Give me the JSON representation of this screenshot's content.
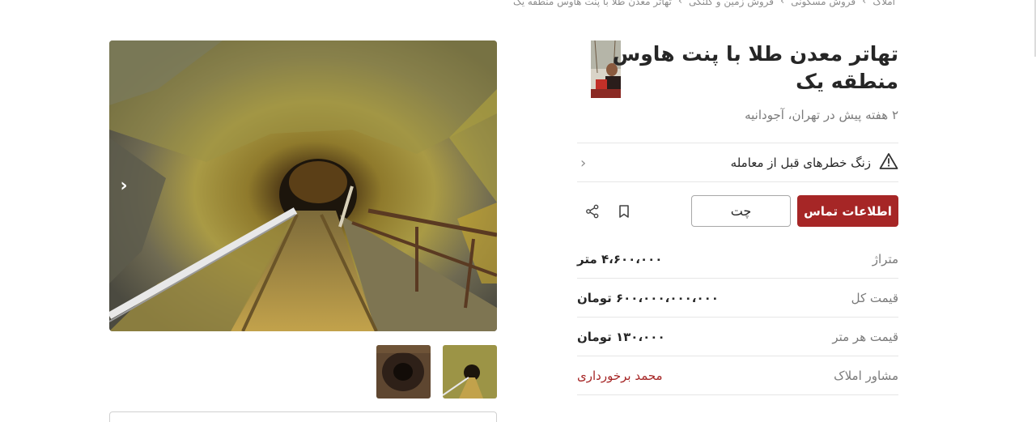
{
  "breadcrumb": {
    "items": [
      "املاک",
      "فروش مسکونی",
      "فروش زمین و کلنگی",
      "تهاتر معدن طلا با پنت هاوس منطقه یک"
    ]
  },
  "listing": {
    "title": "تهاتر معدن طلا با پنت هاوس منطقه یک",
    "subtitle": "۲ هفته پیش در تهران، آجودانیه"
  },
  "warning": {
    "text": "زنگ خطرهای قبل از معامله",
    "icon": "warning-triangle-icon"
  },
  "actions": {
    "contact_label": "اطلاعات تماس",
    "chat_label": "چت",
    "bookmark_icon": "bookmark-icon",
    "share_icon": "share-icon"
  },
  "details": [
    {
      "label": "متراژ",
      "value": "۴،۶۰۰،۰۰۰ متر"
    },
    {
      "label": "قیمت کل",
      "value": "۶۰۰،۰۰۰،۰۰۰،۰۰۰ تومان"
    },
    {
      "label": "قیمت هر متر",
      "value": "۱۳۰،۰۰۰ تومان"
    },
    {
      "label": "مشاور املاک",
      "value": "محمد برخورداری"
    }
  ],
  "colors": {
    "accent": "#a62626",
    "text": "#262626",
    "muted": "#7a7a7a",
    "divider": "#e6e6e6"
  }
}
